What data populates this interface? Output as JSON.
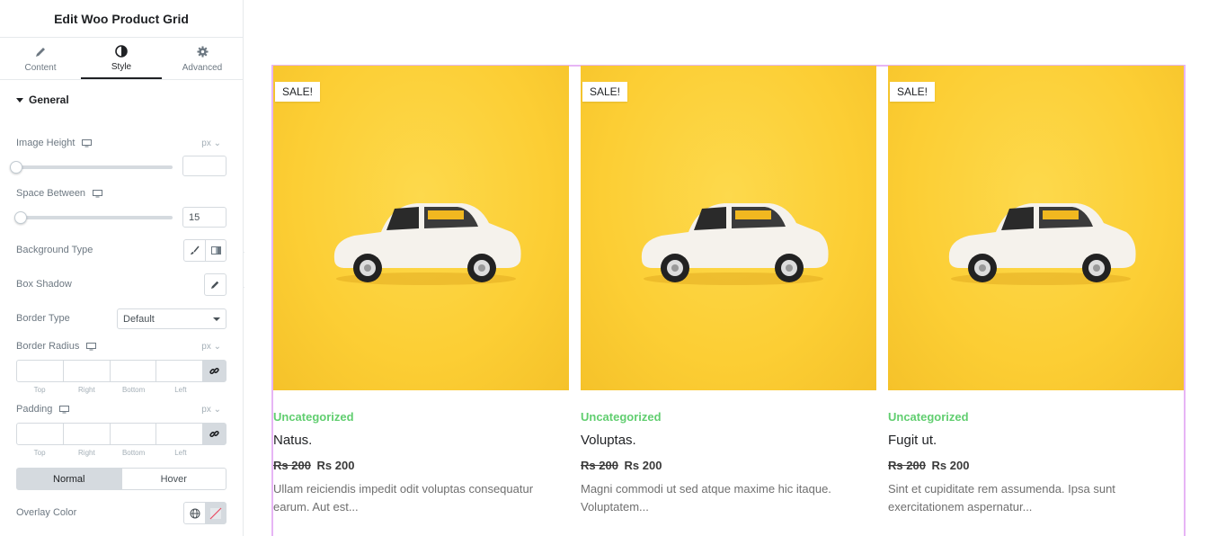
{
  "panel": {
    "title": "Edit Woo Product Grid",
    "tabs": [
      {
        "label": "Content",
        "icon": "pencil-icon",
        "active": false
      },
      {
        "label": "Style",
        "icon": "contrast-icon",
        "active": true
      },
      {
        "label": "Advanced",
        "icon": "gear-icon",
        "active": false
      }
    ],
    "section": "General",
    "controls": {
      "image_height": {
        "label": "Image Height",
        "unit": "px",
        "value": ""
      },
      "space_between": {
        "label": "Space Between",
        "unit": "",
        "value": "15"
      },
      "background_type": {
        "label": "Background Type"
      },
      "box_shadow": {
        "label": "Box Shadow"
      },
      "border_type": {
        "label": "Border Type",
        "value": "Default"
      },
      "border_radius": {
        "label": "Border Radius",
        "unit": "px",
        "sides": [
          "Top",
          "Right",
          "Bottom",
          "Left"
        ]
      },
      "padding": {
        "label": "Padding",
        "unit": "px",
        "sides": [
          "Top",
          "Right",
          "Bottom",
          "Left"
        ]
      },
      "state_toggle": {
        "normal": "Normal",
        "hover": "Hover",
        "active": "Normal"
      },
      "overlay_color": {
        "label": "Overlay Color"
      }
    }
  },
  "products": [
    {
      "badge": "SALE!",
      "category": "Uncategorized",
      "name": "Natus.",
      "old_price": "Rs 200",
      "price": "Rs 200",
      "description": "Ullam reiciendis impedit odit voluptas consequatur earum. Aut est..."
    },
    {
      "badge": "SALE!",
      "category": "Uncategorized",
      "name": "Voluptas.",
      "old_price": "Rs 200",
      "price": "Rs 200",
      "description": "Magni commodi ut sed atque maxime hic itaque. Voluptatem..."
    },
    {
      "badge": "SALE!",
      "category": "Uncategorized",
      "name": "Fugit ut.",
      "old_price": "Rs 200",
      "price": "Rs 200",
      "description": "Sint et cupiditate rem assumenda. Ipsa sunt exercitationem aspernatur..."
    }
  ],
  "colors": {
    "accent_green": "#61ce70",
    "image_bg": "#fcce34",
    "frame": "#e7b5f5"
  }
}
